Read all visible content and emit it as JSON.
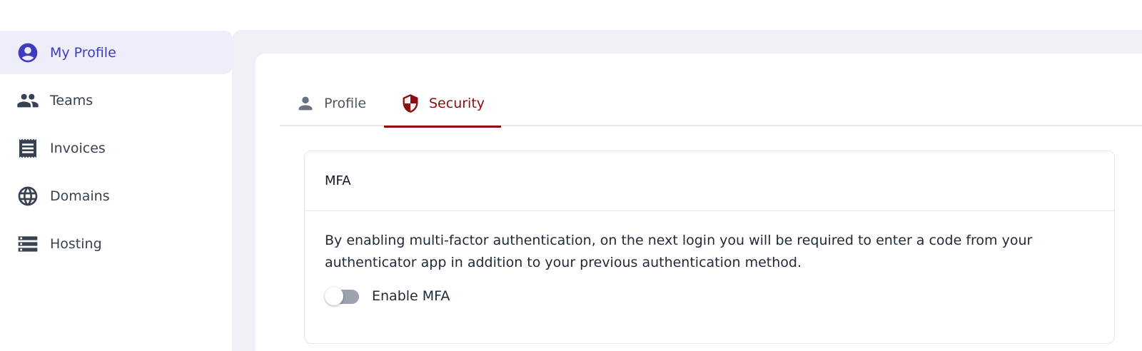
{
  "sidebar": {
    "items": [
      {
        "label": "My Profile",
        "icon": "account-circle-icon",
        "active": true
      },
      {
        "label": "Teams",
        "icon": "group-icon",
        "active": false
      },
      {
        "label": "Invoices",
        "icon": "receipt-icon",
        "active": false
      },
      {
        "label": "Domains",
        "icon": "globe-icon",
        "active": false
      },
      {
        "label": "Hosting",
        "icon": "server-icon",
        "active": false
      }
    ]
  },
  "tabs": [
    {
      "label": "Profile",
      "icon": "person-icon",
      "active": false
    },
    {
      "label": "Security",
      "icon": "shield-icon",
      "active": true
    }
  ],
  "mfa": {
    "title": "MFA",
    "description": "By enabling multi-factor authentication, on the next login you will be required to enter a code from your authenticator app in addition to your previous authentication method.",
    "toggle_label": "Enable MFA",
    "enabled": false
  },
  "colors": {
    "accent": "#3f3dbf",
    "active_nav_bg": "#eeeefb",
    "security_red": "#8b0e10",
    "main_bg": "#eef0f5"
  }
}
